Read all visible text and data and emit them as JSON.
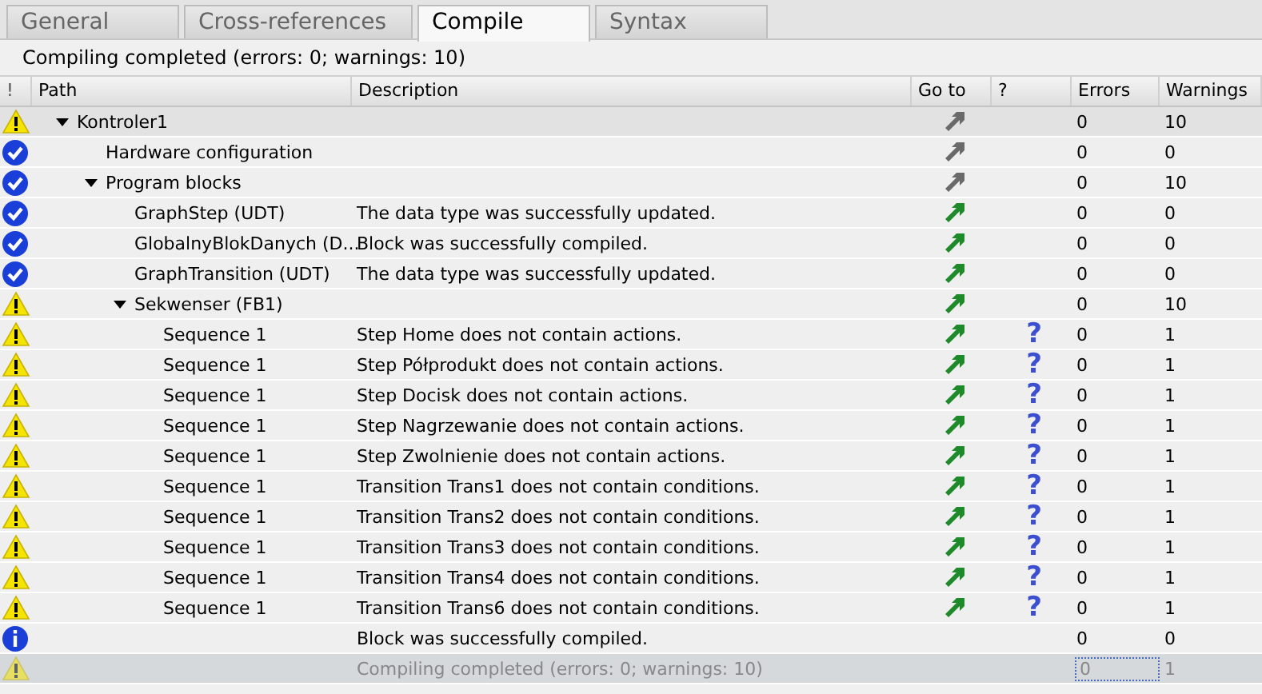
{
  "tabs": [
    {
      "label": "General",
      "selected": false
    },
    {
      "label": "Cross-references",
      "selected": false
    },
    {
      "label": "Compile",
      "selected": true
    },
    {
      "label": "Syntax",
      "selected": false
    }
  ],
  "summary": "Compiling completed (errors: 0; warnings: 10)",
  "table": {
    "columns": [
      "!",
      "Path",
      "Description",
      "Go to",
      "?",
      "Errors",
      "Warnings"
    ],
    "rows": [
      {
        "kind": "warning",
        "path": "Kontroler1",
        "expanded": true,
        "goto_active": false,
        "errors": "0",
        "warnings": "10",
        "selected": false,
        "children": [
          {
            "kind": "ok",
            "path": "Hardware configuration",
            "goto_active": false,
            "errors": "0",
            "warnings": "0",
            "selected": false
          },
          {
            "kind": "ok",
            "path": "Program blocks",
            "expanded": true,
            "goto_active": false,
            "errors": "0",
            "warnings": "10",
            "selected": false,
            "children": [
              {
                "kind": "ok",
                "path": "GraphStep (UDT)",
                "description": "The data type was successfully updated.",
                "goto_active": true,
                "errors": "0",
                "warnings": "0",
                "selected": false
              },
              {
                "kind": "ok",
                "path": "GlobalnyBlokDanych (D...",
                "description": "Block was successfully compiled.",
                "goto_active": true,
                "errors": "0",
                "warnings": "0",
                "selected": false
              },
              {
                "kind": "ok",
                "path": "GraphTransition (UDT)",
                "description": "The data type was successfully updated.",
                "goto_active": true,
                "errors": "0",
                "warnings": "0",
                "selected": false
              },
              {
                "kind": "warning",
                "path": "Sekwenser (FB1)",
                "expanded": true,
                "goto_active": true,
                "errors": "0",
                "warnings": "10",
                "selected": false,
                "children": [
                  {
                    "kind": "warning",
                    "path": "Sequence 1",
                    "description": "Step Home does not contain actions.",
                    "goto_active": true,
                    "help": "?",
                    "errors": "0",
                    "warnings": "1",
                    "selected": false
                  },
                  {
                    "kind": "warning",
                    "path": "Sequence 1",
                    "description": "Step Półprodukt does not contain actions.",
                    "goto_active": true,
                    "help": "?",
                    "errors": "0",
                    "warnings": "1",
                    "selected": false
                  },
                  {
                    "kind": "warning",
                    "path": "Sequence 1",
                    "description": "Step Docisk does not contain actions.",
                    "goto_active": true,
                    "help": "?",
                    "errors": "0",
                    "warnings": "1",
                    "selected": false
                  },
                  {
                    "kind": "warning",
                    "path": "Sequence 1",
                    "description": "Step Nagrzewanie does not contain actions.",
                    "goto_active": true,
                    "help": "?",
                    "errors": "0",
                    "warnings": "1",
                    "selected": false
                  },
                  {
                    "kind": "warning",
                    "path": "Sequence 1",
                    "description": "Step Zwolnienie does not contain actions.",
                    "goto_active": true,
                    "help": "?",
                    "errors": "0",
                    "warnings": "1",
                    "selected": false
                  },
                  {
                    "kind": "warning",
                    "path": "Sequence 1",
                    "description": "Transition Trans1 does not contain conditions.",
                    "goto_active": true,
                    "help": "?",
                    "errors": "0",
                    "warnings": "1",
                    "selected": false
                  },
                  {
                    "kind": "warning",
                    "path": "Sequence 1",
                    "description": "Transition Trans2 does not contain conditions.",
                    "goto_active": true,
                    "help": "?",
                    "errors": "0",
                    "warnings": "1",
                    "selected": false
                  },
                  {
                    "kind": "warning",
                    "path": "Sequence 1",
                    "description": "Transition Trans3 does not contain conditions.",
                    "goto_active": true,
                    "help": "?",
                    "errors": "0",
                    "warnings": "1",
                    "selected": false
                  },
                  {
                    "kind": "warning",
                    "path": "Sequence 1",
                    "description": "Transition Trans4 does not contain conditions.",
                    "goto_active": true,
                    "help": "?",
                    "errors": "0",
                    "warnings": "1",
                    "selected": false
                  },
                  {
                    "kind": "warning",
                    "path": "Sequence 1",
                    "description": "Transition Trans6 does not contain conditions.",
                    "goto_active": true,
                    "help": "?",
                    "errors": "0",
                    "warnings": "1",
                    "selected": false
                  }
                ]
              }
            ]
          }
        ]
      },
      {
        "kind": "info",
        "description": "Block was successfully compiled.",
        "errors": "0",
        "warnings": "0",
        "selected": false
      },
      {
        "kind": "warning",
        "description": "Compiling completed (errors: 0; warnings: 10)",
        "errors": "0",
        "warnings": "1",
        "selected": true
      }
    ]
  }
}
